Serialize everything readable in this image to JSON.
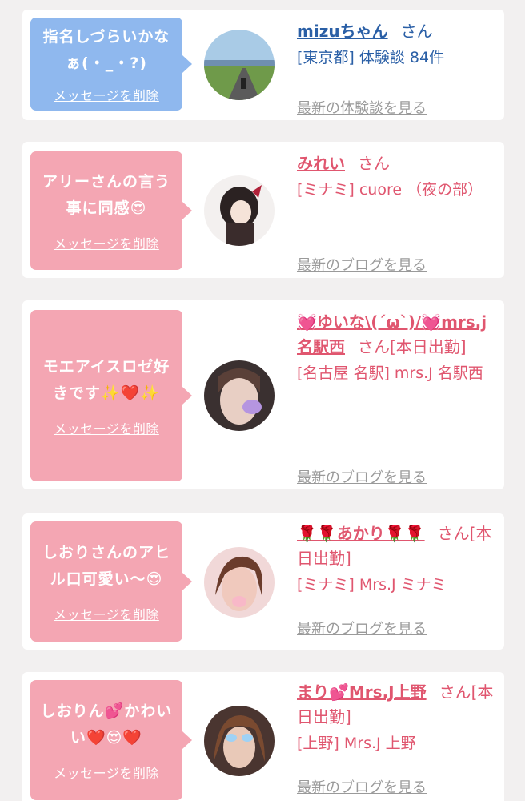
{
  "items": [
    {
      "message": "指名しづらいかなぁ(・_・?)",
      "delete_label": "メッセージを削除",
      "name": "mizuちゃん",
      "suffix": "さん",
      "meta": "[東京都] 体験談 84件",
      "more": "最新の体験談を見る",
      "theme": "blue"
    },
    {
      "message": "アリーさんの言う事に同感😍",
      "delete_label": "メッセージを削除",
      "name": "みれい",
      "suffix": "さん",
      "meta": "[ミナミ] cuore （夜の部）",
      "more": "最新のブログを見る",
      "theme": "pink"
    },
    {
      "message": "モエアイスロゼ好きです✨❤️✨",
      "delete_label": "メッセージを削除",
      "name": "💓ゆいな\\(´ω`)/💓mrs.j名駅西",
      "suffix": "さん[本日出勤]",
      "meta": "[名古屋 名駅] mrs.J 名駅西",
      "more": "最新のブログを見る",
      "theme": "pink"
    },
    {
      "message": "しおりさんのアヒル口可愛い〜😍",
      "delete_label": "メッセージを削除",
      "name": "🌹🌹あかり🌹🌹",
      "suffix": "さん[本日出勤]",
      "meta": "[ミナミ] Mrs.J ミナミ",
      "more": "最新のブログを見る",
      "theme": "pink"
    },
    {
      "message": "しおりん💕かわいい❤️😍❤️",
      "delete_label": "メッセージを削除",
      "name": "まり💕Mrs.J上野",
      "suffix": "さん[本日出勤]",
      "meta": "[上野] Mrs.J 上野",
      "more": "最新のブログを見る",
      "theme": "pink"
    }
  ],
  "colors": {
    "blue_bubble": "#8fb8ee",
    "pink_bubble": "#f4a6b3",
    "blue_text": "#2a5fa6",
    "pink_text": "#e0566f",
    "link_gray": "#9a9a9a",
    "background": "#f2f0f0"
  }
}
